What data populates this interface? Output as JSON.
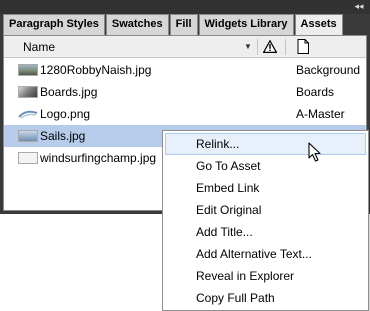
{
  "panel": {
    "collapse_glyph": "◂◂",
    "tabs": [
      {
        "label": "Paragraph Styles",
        "active": false
      },
      {
        "label": "Swatches",
        "active": false
      },
      {
        "label": "Fill",
        "active": false
      },
      {
        "label": "Widgets Library",
        "active": false
      },
      {
        "label": "Assets",
        "active": true
      }
    ],
    "header": {
      "name_label": "Name",
      "sort_glyph": "▼",
      "status_icon": "warning-icon",
      "page_icon": "page-icon"
    },
    "assets": [
      {
        "name": "1280RobbyNaish.jpg",
        "layer": "Background",
        "thumbnail": "photo-thumbnail",
        "selected": false
      },
      {
        "name": "Boards.jpg",
        "layer": "Boards",
        "thumbnail": "photo-thumbnail",
        "selected": false
      },
      {
        "name": "Logo.png",
        "layer": "A-Master",
        "thumbnail": "logo-thumbnail",
        "selected": false
      },
      {
        "name": "Sails.jpg",
        "layer": "",
        "thumbnail": "photo-thumbnail",
        "selected": true
      },
      {
        "name": "windsurfingchamp.jpg",
        "layer": "",
        "thumbnail": "photo-thumbnail",
        "selected": false
      }
    ]
  },
  "context_menu": {
    "items": [
      {
        "label": "Relink...",
        "hovered": true
      },
      {
        "label": "Go To Asset",
        "hovered": false
      },
      {
        "label": "Embed Link",
        "hovered": false
      },
      {
        "label": "Edit Original",
        "hovered": false
      },
      {
        "label": "Add Title...",
        "hovered": false
      },
      {
        "label": "Add Alternative Text...",
        "hovered": false
      },
      {
        "label": "Reveal in Explorer",
        "hovered": false
      },
      {
        "label": "Copy Full Path",
        "hovered": false
      }
    ]
  },
  "colors": {
    "panel_bg": "#3a3a3a",
    "selected_row": "#b7cbea",
    "menu_hover": "#e8f0fb"
  }
}
